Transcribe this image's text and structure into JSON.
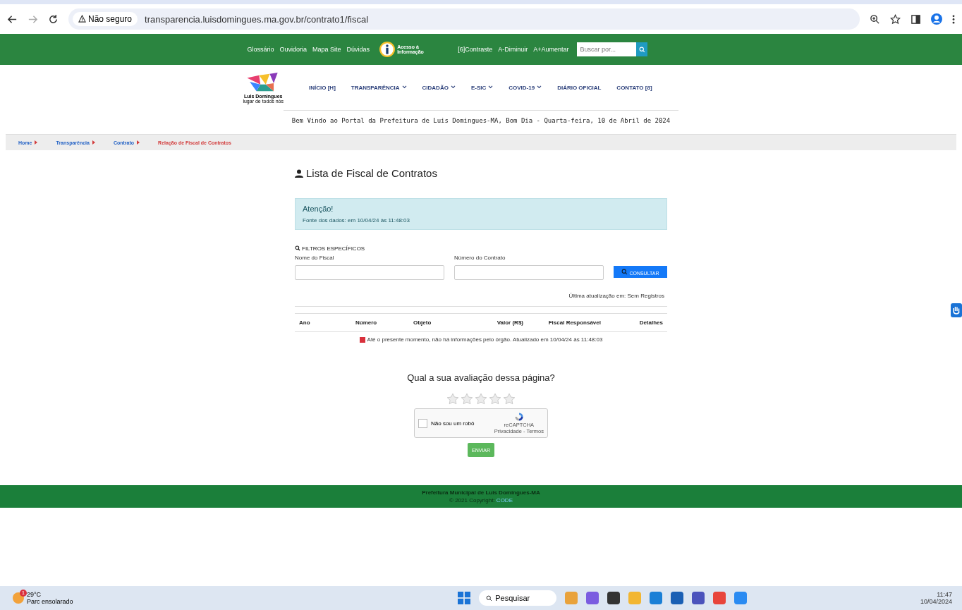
{
  "browser": {
    "security": "Não seguro",
    "url": "transparencia.luisdomingues.ma.gov.br/contrato1/fiscal"
  },
  "top_bar": {
    "links": [
      "Glossário",
      "Ouvidoria",
      "Mapa Site",
      "Dúvidas"
    ],
    "access_badge": "Acesso à Informação",
    "accessibility": [
      "[6]Contraste",
      "A-Diminuir",
      "A+Aumentar"
    ],
    "search": {
      "placeholder": "Buscar por..."
    }
  },
  "logo": {
    "name": "Luis Domingues",
    "tagline": "lugar de todos nós"
  },
  "nav": [
    {
      "label": "INÍCIO [H]",
      "dropdown": false
    },
    {
      "label": "TRANSPARÊNCIA",
      "dropdown": true
    },
    {
      "label": "CIDADÃO",
      "dropdown": true
    },
    {
      "label": "E-SIC",
      "dropdown": true
    },
    {
      "label": "COVID-19",
      "dropdown": true
    },
    {
      "label": "DIÁRIO OFICIAL",
      "dropdown": false
    },
    {
      "label": "CONTATO [8]",
      "dropdown": false
    }
  ],
  "welcome": "Bem Vindo ao Portal da Prefeitura de Luis Domingues-MA, Bom Dia - Quarta-feira, 10 de Abril de 2024",
  "breadcrumb": [
    {
      "label": "Home",
      "current": false
    },
    {
      "label": "Transparência",
      "current": false
    },
    {
      "label": "Contrato",
      "current": false
    },
    {
      "label": "Relação de Fiscal de Contratos",
      "current": true
    }
  ],
  "page_title": "Lista de Fiscal de Contratos",
  "alert": {
    "title": "Atenção!",
    "text": "Fonte dos dados: em 10/04/24 às 11:48:03"
  },
  "filters": {
    "title": "FILTROS ESPECÍFICOS",
    "fields": [
      {
        "label": "Nome do Fiscal"
      },
      {
        "label": "Número do Contrato"
      }
    ],
    "button": "CONSULTAR"
  },
  "last_update": "Última atualização em: Sem Registros",
  "table": {
    "columns": [
      "Ano",
      "Número",
      "Objeto",
      "Valor (R$)",
      "Fiscal Responsável",
      "Detalhes"
    ],
    "empty_message": "Até o presente momento, não há informações pelo órgão. Atualizado em 10/04/24 às 11:48:03"
  },
  "rating": {
    "question": "Qual a sua avaliação dessa página?",
    "stars": 0
  },
  "captcha": {
    "label": "Não sou um robô",
    "checked": false,
    "brand": "reCAPTCHA",
    "links": "Privacidade - Termos"
  },
  "send_button": "ENVIAR",
  "footer": {
    "line1": "Prefeitura Municipal de Luis Domingues-MA",
    "copyright": "© 2021 Copyright:",
    "link": "CODE"
  },
  "taskbar": {
    "weather": {
      "temp": "29°C",
      "desc": "Parc ensolarado",
      "badge": "1"
    },
    "search": "Pesquisar",
    "time": "11:47",
    "date": "10/04/2024"
  }
}
